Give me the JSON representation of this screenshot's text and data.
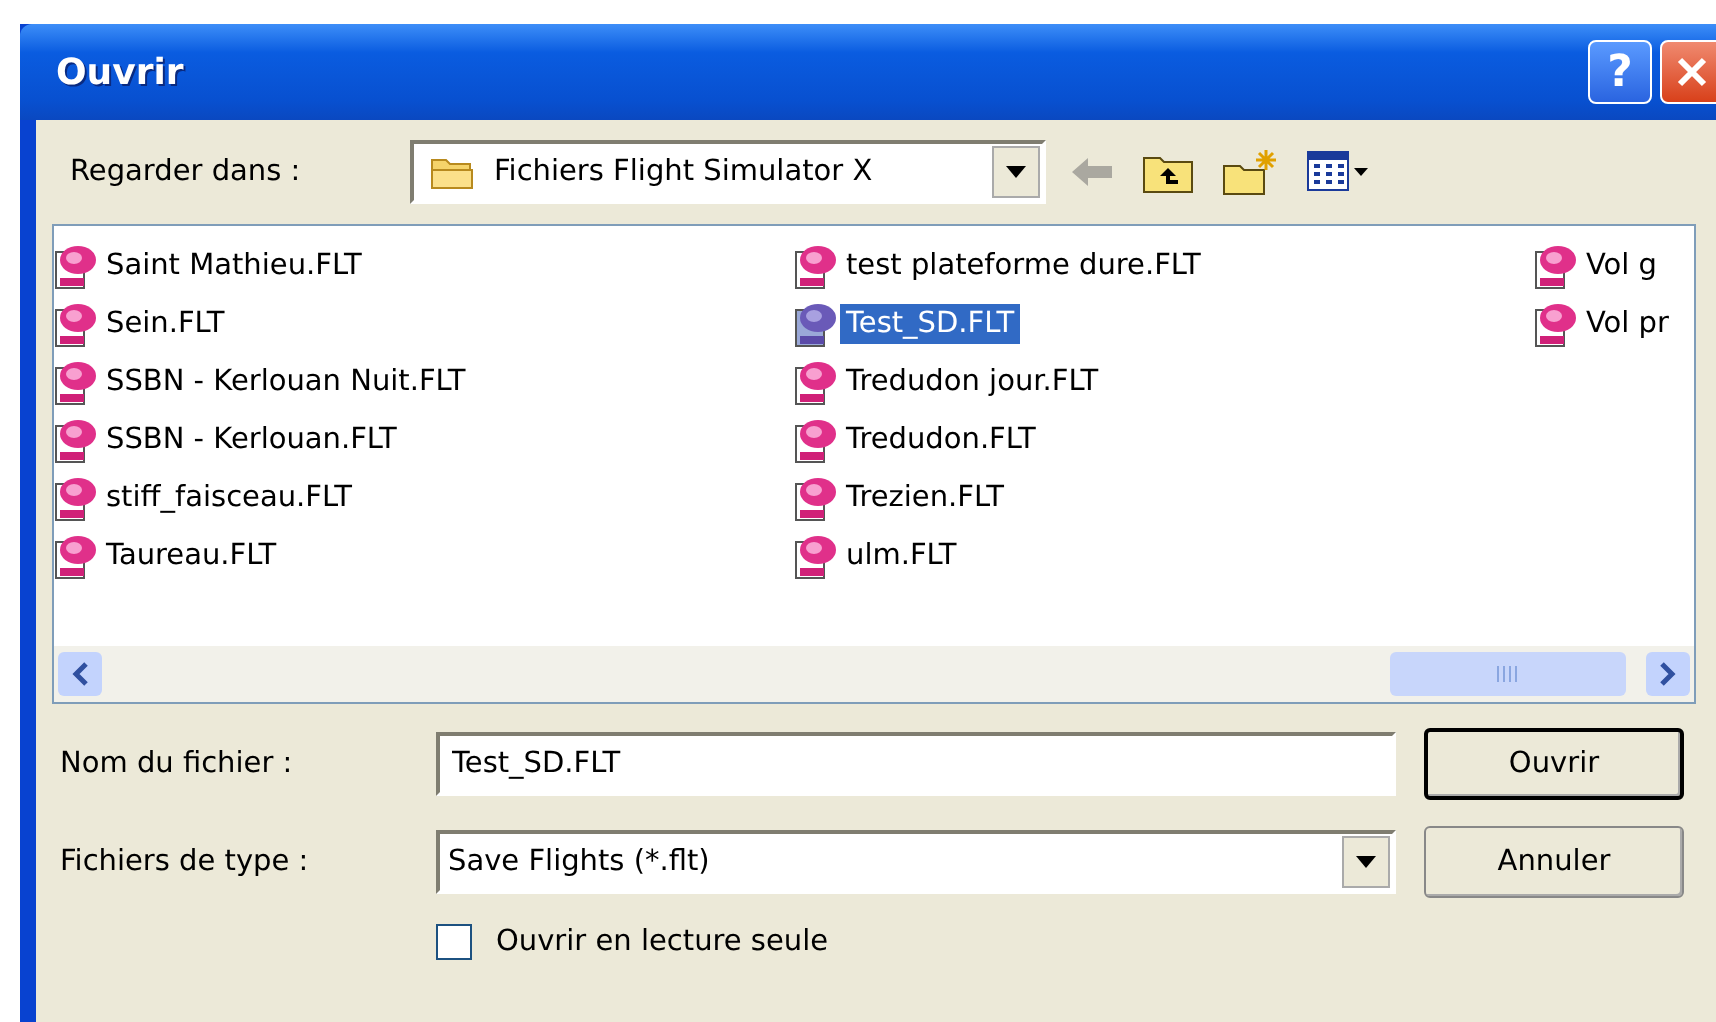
{
  "window": {
    "title": "Ouvrir",
    "help_button": "?"
  },
  "look_in": {
    "label": "Regarder dans :",
    "value": "Fichiers Flight Simulator X"
  },
  "files": [
    {
      "name": "Saint Mathieu.FLT",
      "selected": false
    },
    {
      "name": "Sein.FLT",
      "selected": false
    },
    {
      "name": "SSBN - Kerlouan Nuit.FLT",
      "selected": false
    },
    {
      "name": "SSBN - Kerlouan.FLT",
      "selected": false
    },
    {
      "name": "stiff_faisceau.FLT",
      "selected": false
    },
    {
      "name": "Taureau.FLT",
      "selected": false
    },
    {
      "name": "test plateforme dure.FLT",
      "selected": false
    },
    {
      "name": "Test_SD.FLT",
      "selected": true
    },
    {
      "name": "Tredudon jour.FLT",
      "selected": false
    },
    {
      "name": "Tredudon.FLT",
      "selected": false
    },
    {
      "name": "Trezien.FLT",
      "selected": false
    },
    {
      "name": "ulm.FLT",
      "selected": false
    },
    {
      "name": "Vol g",
      "selected": false
    },
    {
      "name": "Vol pr",
      "selected": false
    }
  ],
  "filename": {
    "label": "Nom du fichier :",
    "value": "Test_SD.FLT"
  },
  "filetype": {
    "label": "Fichiers de type :",
    "value": "Save Flights (*.flt)"
  },
  "buttons": [
    {
      "label": "Ouvrir",
      "default": true
    },
    {
      "label": "Annuler",
      "default": false
    }
  ],
  "readonly": {
    "label": "Ouvrir en lecture seule",
    "checked": false
  }
}
